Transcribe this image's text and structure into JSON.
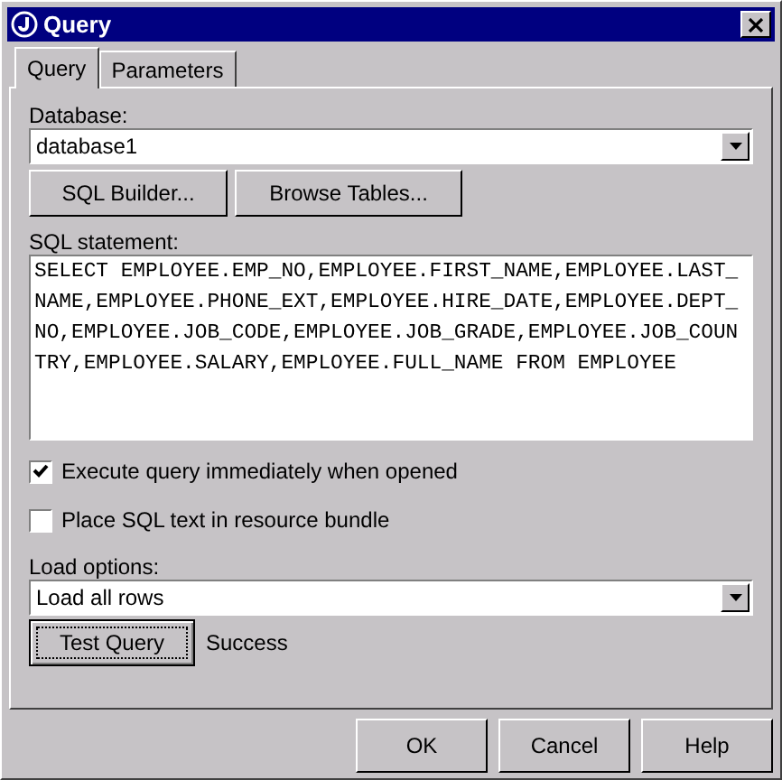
{
  "window": {
    "title": "Query"
  },
  "tabs": [
    {
      "label": "Query",
      "selected": true
    },
    {
      "label": "Parameters",
      "selected": false
    }
  ],
  "database": {
    "label": "Database:",
    "value": "database1"
  },
  "builder_buttons": [
    "SQL Builder...",
    "Browse Tables..."
  ],
  "sql": {
    "label": "SQL statement:",
    "value": "SELECT EMPLOYEE.EMP_NO,EMPLOYEE.FIRST_NAME,EMPLOYEE.LAST_NAME,EMPLOYEE.PHONE_EXT,EMPLOYEE.HIRE_DATE,EMPLOYEE.DEPT_NO,EMPLOYEE.JOB_CODE,EMPLOYEE.JOB_GRADE,EMPLOYEE.JOB_COUNTRY,EMPLOYEE.SALARY,EMPLOYEE.FULL_NAME FROM EMPLOYEE"
  },
  "options": [
    {
      "label": "Execute query immediately when opened",
      "checked": true
    },
    {
      "label": "Place SQL text in resource bundle",
      "checked": false
    }
  ],
  "load_options": {
    "label": "Load options:",
    "value": "Load all rows"
  },
  "test": {
    "button": "Test Query",
    "result": "Success"
  },
  "buttons": [
    "OK",
    "Cancel",
    "Help"
  ]
}
